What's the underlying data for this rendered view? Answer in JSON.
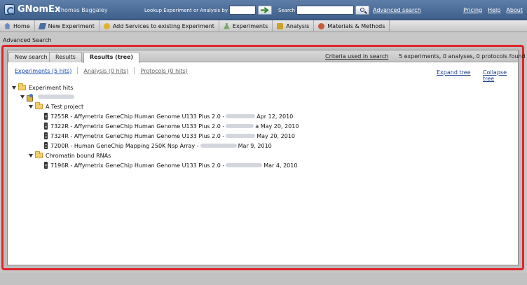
{
  "header": {
    "app_name": "GNomEx",
    "user_name": "Thomas Baggaley",
    "lookup_label": "Lookup Experiment or Analysis by #",
    "lookup_value": "",
    "search_label": "Search",
    "search_value": "",
    "advanced_search_link": "Advanced search",
    "links": [
      "Pricing",
      "Help",
      "About"
    ]
  },
  "nav": {
    "items": [
      {
        "label": "Home",
        "icon": "home-icon"
      },
      {
        "label": "New Experiment",
        "icon": "new-experiment-icon"
      },
      {
        "label": "Add Services to existing Experiment",
        "icon": "add-services-icon"
      },
      {
        "label": "Experiments",
        "icon": "flask-icon"
      },
      {
        "label": "Analysis",
        "icon": "analysis-icon"
      },
      {
        "label": "Materials & Methods",
        "icon": "materials-icon"
      }
    ]
  },
  "page": {
    "title": "Advanced Search"
  },
  "tabs": {
    "items": [
      "New search",
      "Results",
      "Results (tree)"
    ],
    "active": "Results (tree)",
    "criteria_link": "Criteria used in search",
    "summary": "5 experiments, 0 analyses, 0 protocols found"
  },
  "subtabs": {
    "items": [
      "Experiments (5 hits)",
      "Analysis (0 hits)",
      "Protocols (0 hits)"
    ],
    "active": "Experiments (5 hits)",
    "expand": "Expand tree",
    "collapse": "Collapse tree"
  },
  "tree": {
    "root": "Experiment hits",
    "projects": [
      {
        "name": "A Test project",
        "items": [
          {
            "prefix": "7255R - Affymetrix GeneChip Human Genome U133 Plus 2.0 - ",
            "date": "Apr 12, 2010"
          },
          {
            "prefix": "7322R - Affymetrix GeneChip Human Genome U133 Plus 2.0 - ",
            "date": "a May 20, 2010"
          },
          {
            "prefix": "7324R - Affymetrix GeneChip Human Genome U133 Plus 2.0 - ",
            "date": "May 20, 2010"
          },
          {
            "prefix": "7200R - Human GeneChip Mapping 250K Nsp Array - ",
            "date": "Mar 9, 2010"
          }
        ]
      },
      {
        "name": "Chromatin bound RNAs",
        "items": [
          {
            "prefix": "7196R - Affymetrix GeneChip Human Genome U133 Plus 2.0 - ",
            "date": "Mar 4, 2010"
          }
        ]
      }
    ]
  },
  "colors": {
    "header_top": "#5d7ea8",
    "header_bottom": "#3e5f8a",
    "highlight_border": "#e0252a",
    "link_blue": "#1a4fb3"
  }
}
